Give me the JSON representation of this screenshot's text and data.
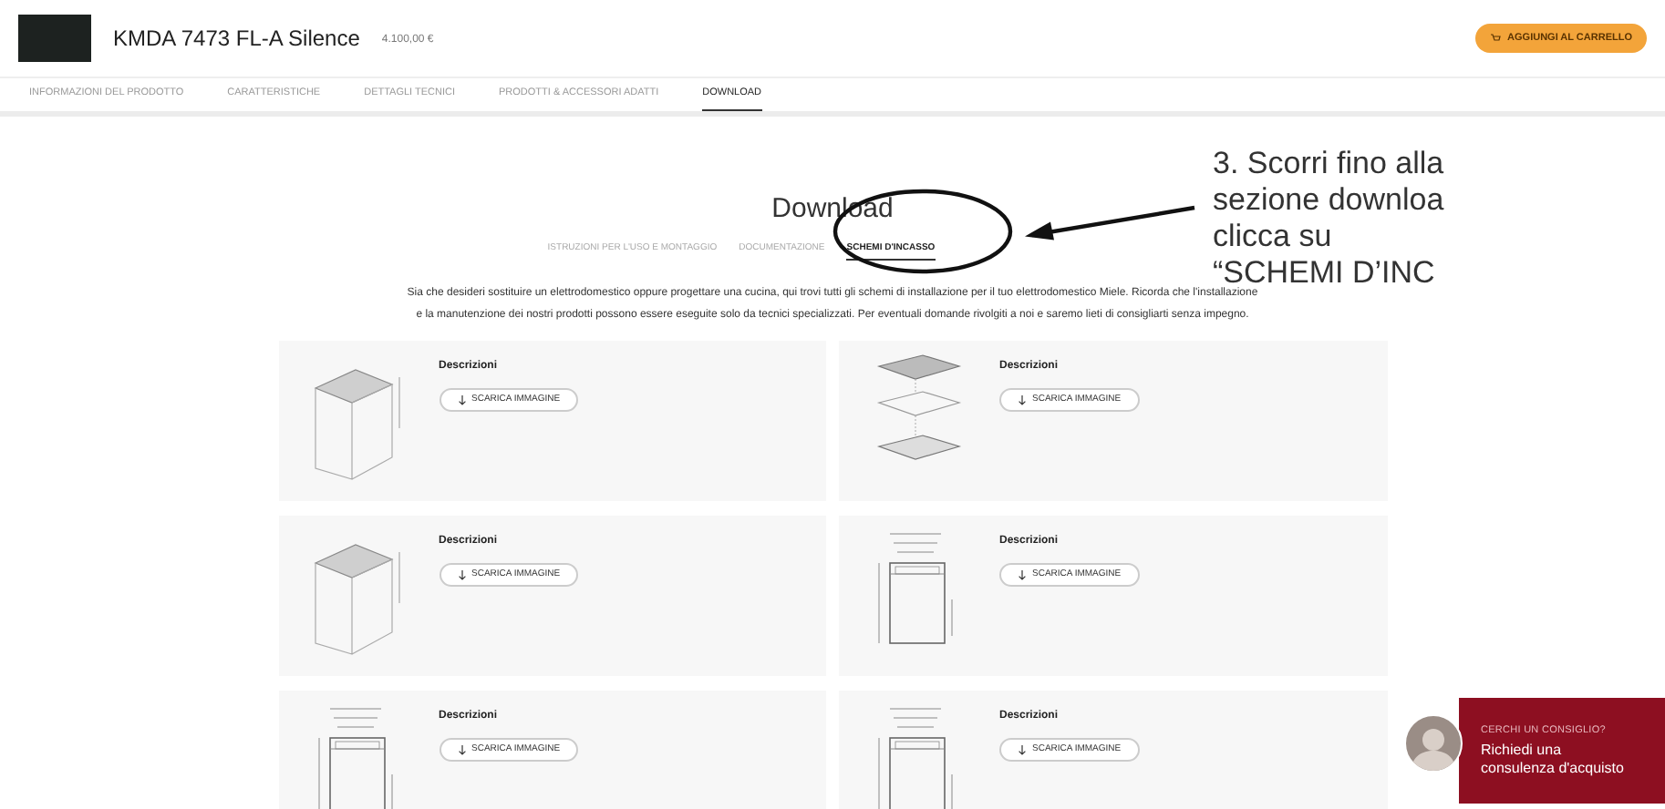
{
  "header": {
    "product_name": "KMDA 7473 FL-A Silence",
    "price": "4.100,00 €",
    "cart_button": "AGGIUNGI AL CARRELLO"
  },
  "nav_tabs": [
    {
      "label": "INFORMAZIONI DEL PRODOTTO",
      "selected": false
    },
    {
      "label": "CARATTERISTICHE",
      "selected": false
    },
    {
      "label": "DETTAGLI TECNICI",
      "selected": false
    },
    {
      "label": "PRODOTTI & ACCESSORI ADATTI",
      "selected": false
    },
    {
      "label": "DOWNLOAD",
      "selected": true
    }
  ],
  "download": {
    "title": "Download",
    "tabs": [
      {
        "label": "ISTRUZIONI PER L'USO E MONTAGGIO",
        "selected": false
      },
      {
        "label": "DOCUMENTAZIONE",
        "selected": false
      },
      {
        "label": "SCHEMI D'INCASSO",
        "selected": true
      }
    ],
    "description": "Sia che desideri sostituire un elettrodomestico oppure progettare una cucina, qui trovi tutti gli schemi di installazione per il tuo elettrodomestico Miele. Ricorda che l'installazione e la manutenzione dei nostri prodotti possono essere eseguite solo da tecnici specializzati. Per eventuali domande rivolgiti a noi e saremo lieti di consigliarti senza impegno.",
    "cards": [
      {
        "kind": "perspective",
        "title": "Descrizioni",
        "button": "SCARICA IMMAGINE"
      },
      {
        "kind": "exploded",
        "title": "Descrizioni",
        "button": "SCARICA IMMAGINE"
      },
      {
        "kind": "perspective",
        "title": "Descrizioni",
        "button": "SCARICA IMMAGINE"
      },
      {
        "kind": "dimension",
        "title": "Descrizioni",
        "button": "SCARICA IMMAGINE"
      },
      {
        "kind": "dimension",
        "title": "Descrizioni",
        "button": "SCARICA IMMAGINE"
      },
      {
        "kind": "dimension",
        "title": "Descrizioni",
        "button": "SCARICA IMMAGINE"
      }
    ]
  },
  "annotation": {
    "lines": [
      "3. Scorri fino alla",
      "sezione downloa",
      "clicca su",
      "“SCHEMI D’INC"
    ]
  },
  "chat_widget": {
    "eyebrow": "CERCHI UN CONSIGLIO?",
    "lines": [
      "Richiedi una",
      "consulenza d'acquisto"
    ]
  }
}
